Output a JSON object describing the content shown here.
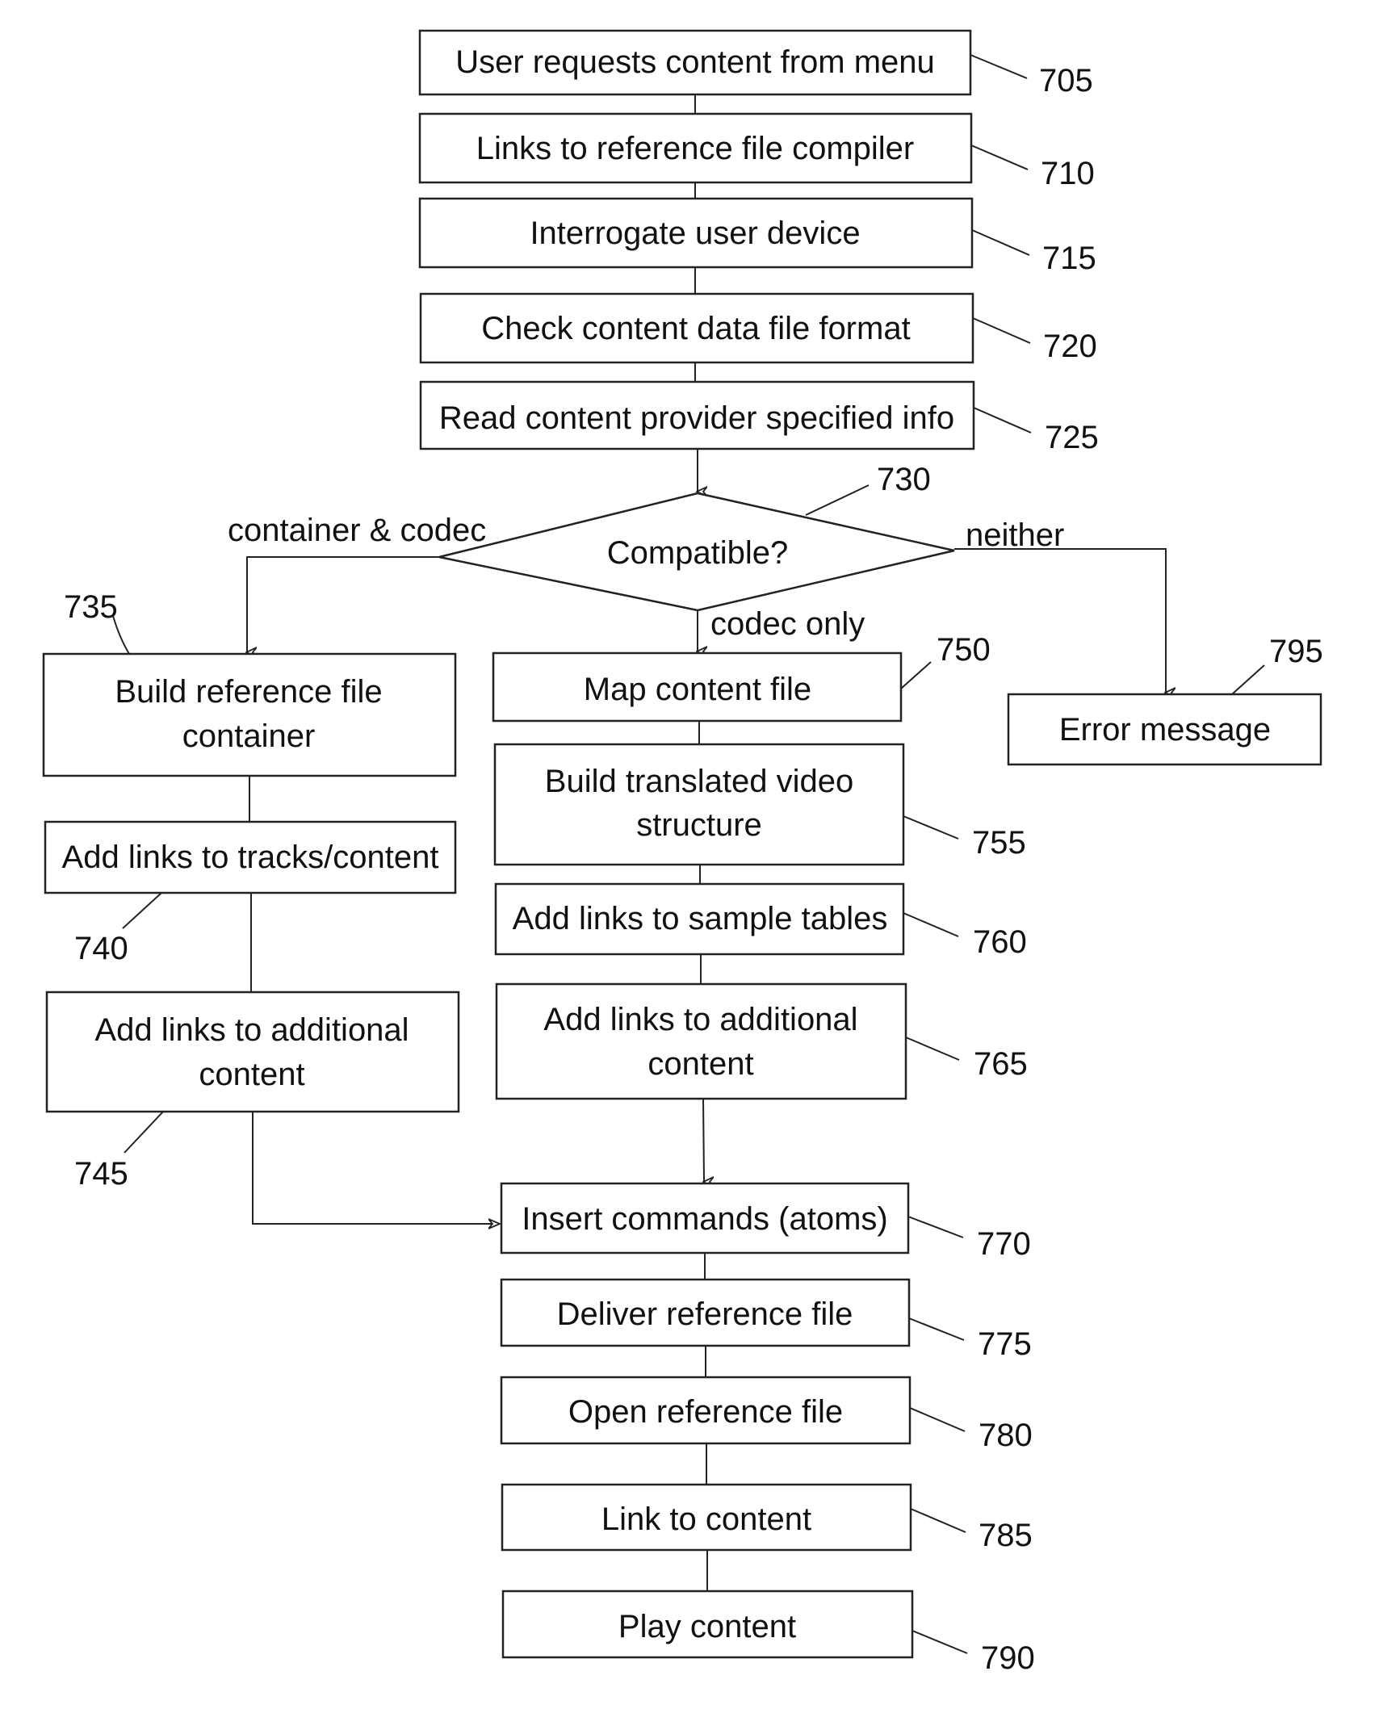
{
  "steps": {
    "s705": {
      "label": "User requests content from menu",
      "ref": "705"
    },
    "s710": {
      "label": "Links to reference file compiler",
      "ref": "710"
    },
    "s715": {
      "label": "Interrogate user device",
      "ref": "715"
    },
    "s720": {
      "label": "Check content data file format",
      "ref": "720"
    },
    "s725": {
      "label": "Read content provider specified info",
      "ref": "725"
    },
    "s730": {
      "label": "Compatible?",
      "ref": "730"
    },
    "s735": {
      "line1": "Build reference file",
      "line2": "container",
      "ref": "735"
    },
    "s740": {
      "label": "Add links to tracks/content",
      "ref": "740"
    },
    "s745": {
      "line1": "Add links to additional",
      "line2": "content",
      "ref": "745"
    },
    "s750": {
      "label": "Map content file",
      "ref": "750"
    },
    "s755": {
      "line1": "Build translated video",
      "line2": "structure",
      "ref": "755"
    },
    "s760": {
      "label": "Add links to sample tables",
      "ref": "760"
    },
    "s765": {
      "line1": "Add links to additional",
      "line2": "content",
      "ref": "765"
    },
    "s770": {
      "label": "Insert commands (atoms)",
      "ref": "770"
    },
    "s775": {
      "label": "Deliver reference file",
      "ref": "775"
    },
    "s780": {
      "label": "Open reference file",
      "ref": "780"
    },
    "s785": {
      "label": "Link to content",
      "ref": "785"
    },
    "s790": {
      "label": "Play content",
      "ref": "790"
    },
    "s795": {
      "label": "Error message",
      "ref": "795"
    }
  },
  "branches": {
    "left": "container & codec",
    "down": "codec only",
    "right": "neither"
  }
}
